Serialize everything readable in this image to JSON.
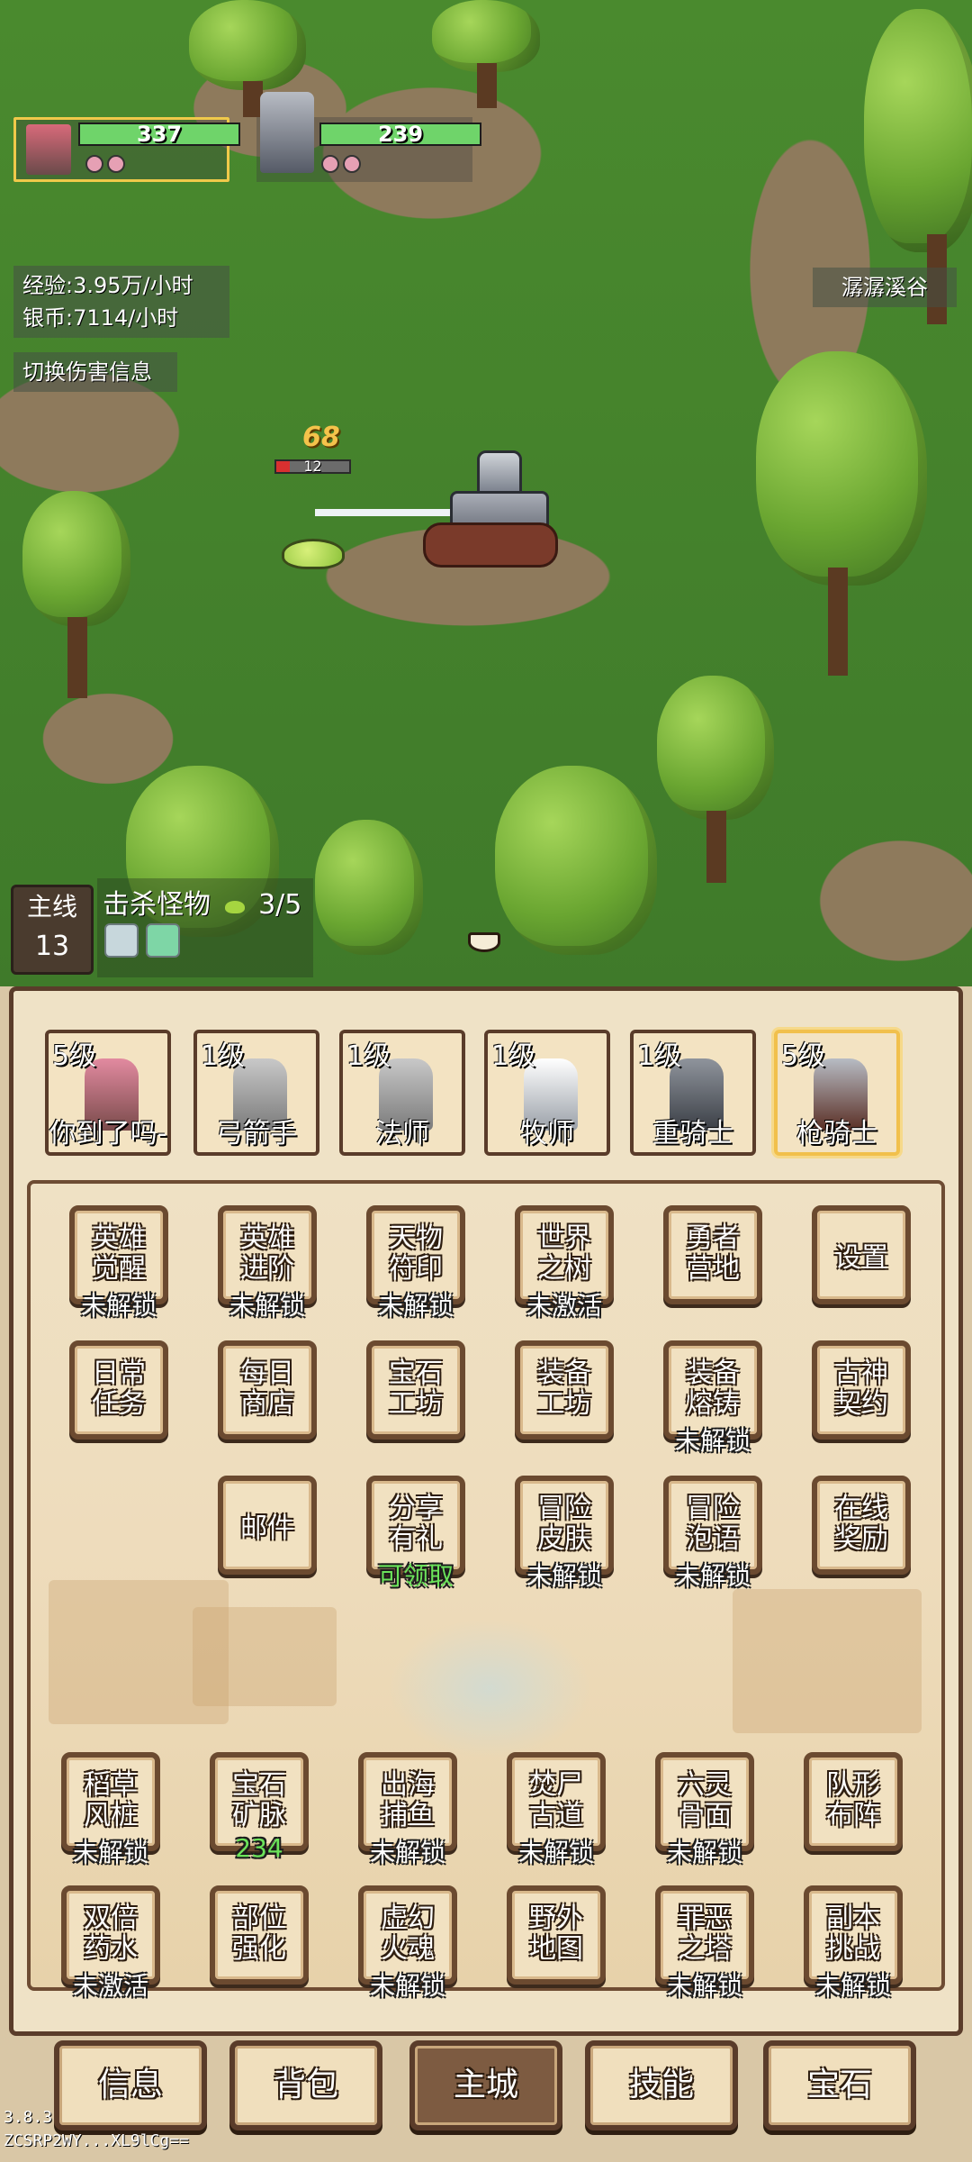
{
  "party": [
    {
      "hp": "337"
    },
    {
      "hp": "239"
    }
  ],
  "stats": {
    "exp": "经验:3.95万/小时",
    "silver": "银币:7114/小时"
  },
  "toggle_damage_label": "切换伤害信息",
  "location": "潺潺溪谷",
  "combat": {
    "damage": "68",
    "enemy_hp": "12"
  },
  "quest": {
    "main_label": "主线",
    "main_level": "13",
    "title": "击杀怪物",
    "progress": "3/5"
  },
  "heroes": [
    {
      "level": "5级",
      "name": "你到了吗-",
      "selected": false
    },
    {
      "level": "1级",
      "name": "弓箭手",
      "selected": false
    },
    {
      "level": "1级",
      "name": "法师",
      "selected": false
    },
    {
      "level": "1级",
      "name": "牧师",
      "selected": false
    },
    {
      "level": "1级",
      "name": "重骑士",
      "selected": false
    },
    {
      "level": "5级",
      "name": "枪骑士",
      "selected": true
    }
  ],
  "menu": {
    "row1": [
      {
        "label": "英雄\n觉醒",
        "status": "未解锁"
      },
      {
        "label": "英雄\n进阶",
        "status": "未解锁"
      },
      {
        "label": "天物\n符印",
        "status": "未解锁"
      },
      {
        "label": "世界\n之树",
        "status": "未激活"
      },
      {
        "label": "勇者\n营地",
        "status": ""
      },
      {
        "label": "设置",
        "status": ""
      }
    ],
    "row2": [
      {
        "label": "日常\n任务",
        "status": ""
      },
      {
        "label": "每日\n商店",
        "status": ""
      },
      {
        "label": "宝石\n工坊",
        "status": ""
      },
      {
        "label": "装备\n工坊",
        "status": ""
      },
      {
        "label": "装备\n熔铸",
        "status": "未解锁"
      },
      {
        "label": "古神\n契约",
        "status": ""
      }
    ],
    "row3": [
      {
        "label": "邮件",
        "status": ""
      },
      {
        "label": "分享\n有礼",
        "status": "可领取"
      },
      {
        "label": "冒险\n皮肤",
        "status": "未解锁"
      },
      {
        "label": "冒险\n泡语",
        "status": "未解锁"
      },
      {
        "label": "在线\n奖励",
        "status": ""
      }
    ],
    "row4": [
      {
        "label": "稻草\n风桩",
        "status": "未解锁"
      },
      {
        "label": "宝石\n矿脉",
        "status": "234"
      },
      {
        "label": "出海\n捕鱼",
        "status": "未解锁"
      },
      {
        "label": "焚尸\n古道",
        "status": "未解锁"
      },
      {
        "label": "六灵\n骨面",
        "status": "未解锁"
      },
      {
        "label": "队形\n布阵",
        "status": ""
      }
    ],
    "row5": [
      {
        "label": "双倍\n药水",
        "status": "未激活"
      },
      {
        "label": "部位\n强化",
        "status": ""
      },
      {
        "label": "虚幻\n火魂",
        "status": "未解锁"
      },
      {
        "label": "野外\n地图",
        "status": ""
      },
      {
        "label": "罪恶\n之塔",
        "status": "未解锁"
      },
      {
        "label": "副本\n挑战",
        "status": "未解锁"
      }
    ]
  },
  "nav": [
    "信息",
    "背包",
    "主城",
    "技能",
    "宝石"
  ],
  "nav_active": 2,
  "version": "3.8.3",
  "build_id": "ZCSRP2WY...XL9lCg=="
}
